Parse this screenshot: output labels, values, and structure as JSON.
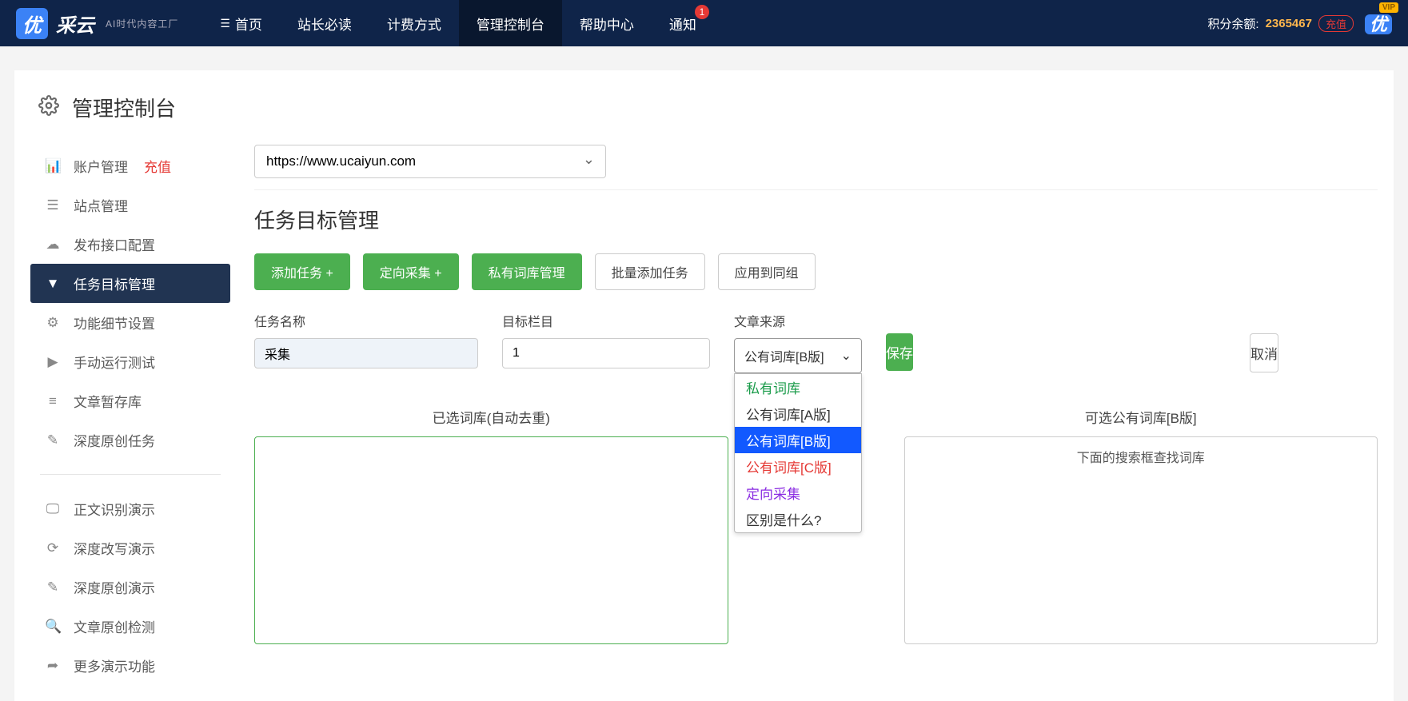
{
  "brand": {
    "badge": "优",
    "name": "采云",
    "sub": "AI时代内容工厂"
  },
  "nav": {
    "items": [
      {
        "label": "首页",
        "icon": "≡"
      },
      {
        "label": "站长必读"
      },
      {
        "label": "计费方式"
      },
      {
        "label": "管理控制台",
        "active": true
      },
      {
        "label": "帮助中心"
      },
      {
        "label": "通知",
        "badge": "1"
      }
    ],
    "points_label": "积分余额:",
    "points_value": "2365467",
    "recharge": "充值",
    "vip_badge": "优",
    "vip_tag": "VIP"
  },
  "page": {
    "title": "管理控制台"
  },
  "sidebar": {
    "group1": [
      {
        "label": "账户管理",
        "tag": "充值",
        "icon": "bar"
      },
      {
        "label": "站点管理",
        "icon": "list"
      },
      {
        "label": "发布接口配置",
        "icon": "cloud"
      },
      {
        "label": "任务目标管理",
        "icon": "filter",
        "active": true
      },
      {
        "label": "功能细节设置",
        "icon": "cogs"
      },
      {
        "label": "手动运行测试",
        "icon": "play"
      },
      {
        "label": "文章暂存库",
        "icon": "db"
      },
      {
        "label": "深度原创任务",
        "icon": "edit"
      }
    ],
    "group2": [
      {
        "label": "正文识别演示",
        "icon": "monitor"
      },
      {
        "label": "深度改写演示",
        "icon": "refresh"
      },
      {
        "label": "深度原创演示",
        "icon": "edit"
      },
      {
        "label": "文章原创检测",
        "icon": "search"
      },
      {
        "label": "更多演示功能",
        "icon": "share"
      }
    ]
  },
  "content": {
    "site_url": "https://www.ucaiyun.com",
    "section_title": "任务目标管理",
    "buttons": {
      "add_task": "添加任务 +",
      "directed": "定向采集 +",
      "private_lib": "私有词库管理",
      "batch_add": "批量添加任务",
      "apply_group": "应用到同组"
    },
    "form": {
      "task_name_label": "任务名称",
      "task_name_value": "采集",
      "target_col_label": "目标栏目",
      "target_col_value": "1",
      "source_label": "文章来源",
      "source_value": "公有词库[B版]",
      "save": "保存",
      "cancel": "取消"
    },
    "dropdown": {
      "private": "私有词库",
      "a": "公有词库[A版]",
      "b": "公有词库[B版]",
      "c": "公有词库[C版]",
      "directed": "定向采集",
      "diff": "区别是什么?"
    },
    "panels": {
      "left_title": "已选词库(自动去重)",
      "right_title": "可选公有词库[B版]",
      "right_hint": "下面的搜索框查找词库"
    }
  }
}
